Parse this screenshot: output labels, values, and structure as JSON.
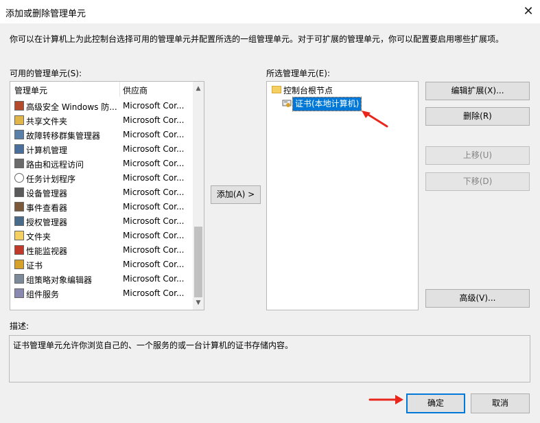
{
  "window": {
    "title": "添加或删除管理单元"
  },
  "intro": "你可以在计算机上为此控制台选择可用的管理单元并配置所选的一组管理单元。对于可扩展的管理单元，你可以配置要启用哪些扩展项。",
  "available": {
    "label": "可用的管理单元(S):",
    "col_name": "管理单元",
    "col_vendor": "供应商",
    "items": [
      {
        "name": "高级安全 Windows 防...",
        "vendor": "Microsoft Cor...",
        "icon": "firewall-icon"
      },
      {
        "name": "共享文件夹",
        "vendor": "Microsoft Cor...",
        "icon": "shared-folder-icon"
      },
      {
        "name": "故障转移群集管理器",
        "vendor": "Microsoft Cor...",
        "icon": "cluster-icon"
      },
      {
        "name": "计算机管理",
        "vendor": "Microsoft Cor...",
        "icon": "computer-management-icon"
      },
      {
        "name": "路由和远程访问",
        "vendor": "Microsoft Cor...",
        "icon": "routing-icon"
      },
      {
        "name": "任务计划程序",
        "vendor": "Microsoft Cor...",
        "icon": "clock-icon"
      },
      {
        "name": "设备管理器",
        "vendor": "Microsoft Cor...",
        "icon": "device-manager-icon"
      },
      {
        "name": "事件查看器",
        "vendor": "Microsoft Cor...",
        "icon": "event-viewer-icon"
      },
      {
        "name": "授权管理器",
        "vendor": "Microsoft Cor...",
        "icon": "authorization-icon"
      },
      {
        "name": "文件夹",
        "vendor": "Microsoft Cor...",
        "icon": "folder-icon"
      },
      {
        "name": "性能监视器",
        "vendor": "Microsoft Cor...",
        "icon": "performance-icon"
      },
      {
        "name": "证书",
        "vendor": "Microsoft Cor...",
        "icon": "certificate-icon"
      },
      {
        "name": "组策略对象编辑器",
        "vendor": "Microsoft Cor...",
        "icon": "group-policy-icon"
      },
      {
        "name": "组件服务",
        "vendor": "Microsoft Cor...",
        "icon": "component-services-icon"
      }
    ]
  },
  "add_button": "添加(A) >",
  "selected": {
    "label": "所选管理单元(E):",
    "root": "控制台根节点",
    "child": "证书(本地计算机)"
  },
  "buttons": {
    "edit_ext": "编辑扩展(X)...",
    "remove": "删除(R)",
    "move_up": "上移(U)",
    "move_down": "下移(D)",
    "advanced": "高级(V)...",
    "ok": "确定",
    "cancel": "取消"
  },
  "description": {
    "label": "描述:",
    "text": "证书管理单元允许你浏览自己的、一个服务的或一台计算机的证书存储内容。"
  },
  "colors": {
    "selection": "#0078d7",
    "arrow": "#e8261c"
  }
}
